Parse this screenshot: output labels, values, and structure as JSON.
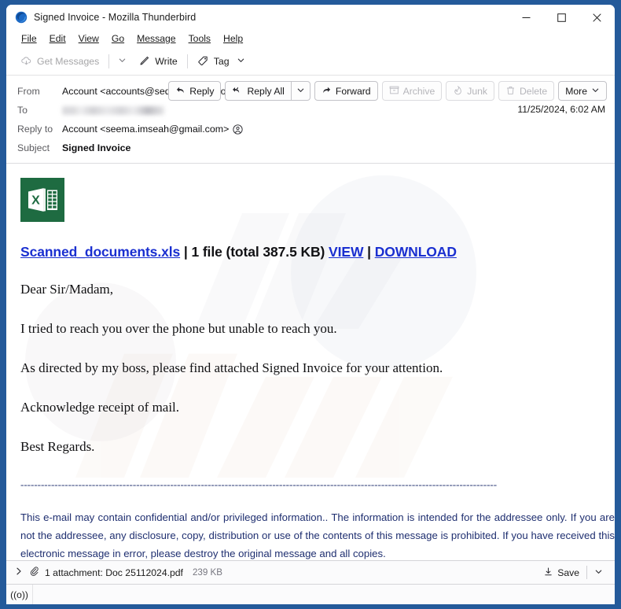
{
  "window": {
    "title": "Signed Invoice - Mozilla Thunderbird",
    "logo_icon": "thunderbird-logo",
    "controls": {
      "minimize": "minimize-icon",
      "maximize": "maximize-icon",
      "close": "close-icon"
    }
  },
  "menubar": {
    "items": [
      {
        "label": "File",
        "mnemonic": "F"
      },
      {
        "label": "Edit",
        "mnemonic": "E"
      },
      {
        "label": "View",
        "mnemonic": "V"
      },
      {
        "label": "Go",
        "mnemonic": "G"
      },
      {
        "label": "Message",
        "mnemonic": "M"
      },
      {
        "label": "Tools",
        "mnemonic": "T"
      },
      {
        "label": "Help",
        "mnemonic": "H"
      }
    ]
  },
  "toolbar": {
    "get_messages_label": "Get Messages",
    "get_messages_icon": "cloud-download-icon",
    "get_messages_caret_icon": "chevron-down-icon",
    "write_label": "Write",
    "write_icon": "pencil-icon",
    "tag_label": "Tag",
    "tag_icon": "tag-icon",
    "tag_caret_icon": "chevron-down-icon"
  },
  "header": {
    "rows": [
      {
        "label": "From",
        "value": "Account <accounts@sedex-asia-th.com>",
        "icon": "contact-icon"
      },
      {
        "label": "To",
        "value": "",
        "redacted": true
      },
      {
        "label": "Reply to",
        "value": "Account <seema.imseah@gmail.com>",
        "icon": "contact-icon"
      },
      {
        "label": "Subject",
        "value": "Signed Invoice",
        "bold": true
      }
    ],
    "date": "11/25/2024, 6:02 AM",
    "actions": [
      {
        "label": "Reply",
        "icon": "reply-icon",
        "enabled": true
      },
      {
        "label": "Reply All",
        "icon": "reply-all-icon",
        "enabled": true
      },
      {
        "label": "",
        "icon": "chevron-down-icon",
        "enabled": true
      },
      {
        "label": "Forward",
        "icon": "forward-icon",
        "enabled": true
      },
      {
        "label": "Archive",
        "icon": "archive-icon",
        "enabled": false
      },
      {
        "label": "Junk",
        "icon": "junk-icon",
        "enabled": false
      },
      {
        "label": "Delete",
        "icon": "trash-icon",
        "enabled": false
      },
      {
        "label": "More",
        "icon": "chevron-down-icon",
        "enabled": true
      }
    ]
  },
  "message": {
    "excel_icon": "excel-file-icon",
    "file_link": {
      "filename": "Scanned_documents.xls",
      "separator_1": " | ",
      "file_info": "1 file (total 387.5 KB) ",
      "view_label": "VIEW",
      "separator_2": " | ",
      "download_label": "DOWNLOAD"
    },
    "paragraphs": [
      "Dear Sir/Madam,",
      "I tried to reach you over the phone but unable to reach you.",
      "As directed by my boss, please find attached Signed Invoice for your attention.",
      "Acknowledge receipt of mail.",
      "Best Regards."
    ],
    "divider": "--------------------------------------------------------------------------------------------------------------------------------------------",
    "disclaimer": "This e-mail may contain confidential and/or privileged information.. The information is intended for the addressee only. If you are not the addressee, any disclosure, copy, distribution or use of the contents of this message is prohibited. If you have received this electronic message in error, please destroy the original message and all copies."
  },
  "attachment_bar": {
    "expand_icon": "chevron-right-icon",
    "paperclip_icon": "paperclip-icon",
    "text": "1 attachment: Doc 25112024.pdf",
    "size": "239 KB",
    "save_label": "Save",
    "save_icon": "download-icon",
    "save_caret_icon": "chevron-down-icon"
  },
  "status_bar": {
    "indicator_icon": "broadcast-icon",
    "indicator_glyph": "((o))"
  },
  "colors": {
    "frame_blue": "#245a9a",
    "link_blue": "#1a2fd0",
    "disclaimer_navy": "#1f2f70",
    "excel_green": "#217346"
  }
}
